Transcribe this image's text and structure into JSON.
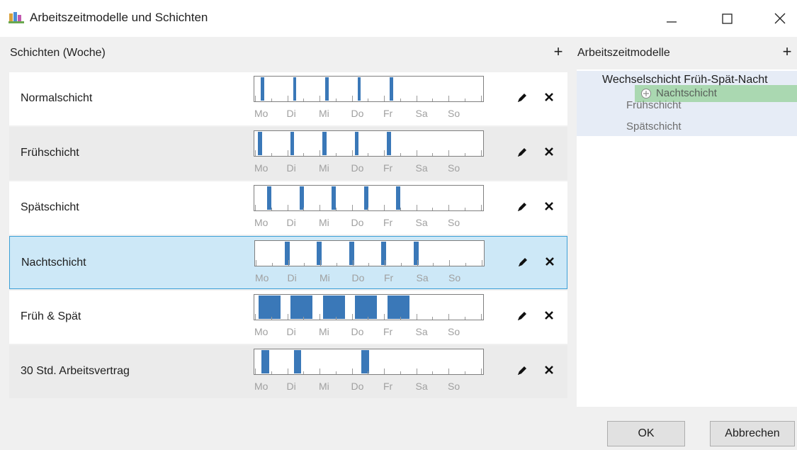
{
  "window": {
    "title": "Arbeitszeitmodelle und Schichten",
    "icon": "app-icon",
    "controls": [
      "minimize",
      "maximize",
      "close"
    ]
  },
  "shifts_panel": {
    "title": "Schichten (Woche)",
    "add_icon": "plus-icon",
    "days": [
      "Mo",
      "Di",
      "Mi",
      "Do",
      "Fr",
      "Sa",
      "So"
    ],
    "bar_color": "#3a78b8",
    "selected_row": "Nachtschicht",
    "rows": [
      {
        "label": "Normalschicht",
        "blocks": [
          [
            0.18,
            0.28
          ],
          [
            1.18,
            1.28
          ],
          [
            2.18,
            2.28
          ],
          [
            3.18,
            3.28
          ],
          [
            4.18,
            4.28
          ]
        ]
      },
      {
        "label": "Frühschicht",
        "blocks": [
          [
            0.09,
            0.21
          ],
          [
            1.09,
            1.21
          ],
          [
            2.09,
            2.21
          ],
          [
            3.09,
            3.21
          ],
          [
            4.09,
            4.21
          ]
        ]
      },
      {
        "label": "Spätschicht",
        "blocks": [
          [
            0.38,
            0.51
          ],
          [
            1.38,
            1.51
          ],
          [
            2.38,
            2.51
          ],
          [
            3.38,
            3.51
          ],
          [
            4.38,
            4.51
          ]
        ]
      },
      {
        "label": "Nachtschicht",
        "blocks": [
          [
            0.9,
            1.05
          ],
          [
            1.9,
            2.05
          ],
          [
            2.9,
            3.05
          ],
          [
            3.9,
            4.05
          ],
          [
            4.9,
            5.05
          ]
        ]
      },
      {
        "label": "Früh & Spät",
        "blocks": [
          [
            0.1,
            0.79
          ],
          [
            1.1,
            1.79
          ],
          [
            2.1,
            2.79
          ],
          [
            3.1,
            3.79
          ],
          [
            4.1,
            4.79
          ]
        ]
      },
      {
        "label": "30 Std. Arbeitsvertrag",
        "blocks": [
          [
            0.2,
            0.43
          ],
          [
            1.2,
            1.43
          ],
          [
            3.3,
            3.53
          ]
        ]
      }
    ]
  },
  "models_panel": {
    "title": "Arbeitszeitmodelle",
    "add_icon": "plus-icon",
    "models": [
      {
        "name": "Wechselschicht Früh-Spät-Nacht",
        "shifts": [
          "Frühschicht",
          "Spätschicht"
        ]
      }
    ],
    "drag_ghost": {
      "label": "Nachtschicht",
      "icon": "drag-cursor-icon"
    }
  },
  "footer": {
    "ok_label": "OK",
    "cancel_label": "Abbrechen"
  }
}
